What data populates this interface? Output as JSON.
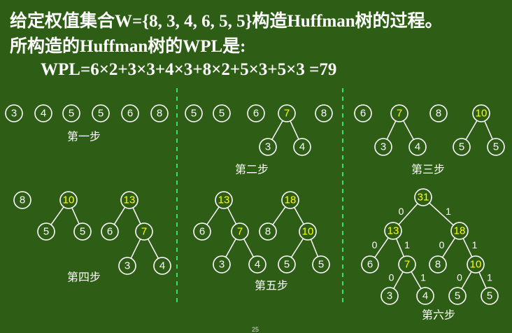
{
  "title": {
    "line1": "给定权值集合W={8, 3, 4, 6, 5, 5}构造Huffman树的过程。",
    "line2": "所构造的Huffman树的WPL是:"
  },
  "formula": "WPL=6×2+3×3+4×3+8×2+5×3+5×3 =79",
  "colors": {
    "background": "#2e5e16",
    "text": "#ffffff",
    "merged_node_text": "#ffff00",
    "divider": "#33e070"
  },
  "steps": [
    {
      "label": "第一步",
      "roots": [
        {
          "value": "3"
        },
        {
          "value": "4"
        },
        {
          "value": "5"
        },
        {
          "value": "5"
        },
        {
          "value": "6"
        },
        {
          "value": "8"
        }
      ]
    },
    {
      "label": "第二步",
      "roots": [
        {
          "value": "5"
        },
        {
          "value": "5"
        },
        {
          "value": "6"
        },
        {
          "value": "7",
          "merged": true,
          "children": [
            {
              "value": "3"
            },
            {
              "value": "4"
            }
          ]
        },
        {
          "value": "8"
        }
      ]
    },
    {
      "label": "第三步",
      "roots": [
        {
          "value": "6"
        },
        {
          "value": "7",
          "merged": true,
          "children": [
            {
              "value": "3"
            },
            {
              "value": "4"
            }
          ]
        },
        {
          "value": "8"
        },
        {
          "value": "10",
          "merged": true,
          "children": [
            {
              "value": "5"
            },
            {
              "value": "5"
            }
          ]
        }
      ]
    },
    {
      "label": "第四步",
      "roots": [
        {
          "value": "8"
        },
        {
          "value": "10",
          "merged": true,
          "children": [
            {
              "value": "5"
            },
            {
              "value": "5"
            }
          ]
        },
        {
          "value": "13",
          "merged": true,
          "children": [
            {
              "value": "6"
            },
            {
              "value": "7",
              "merged": true,
              "children": [
                {
                  "value": "3"
                },
                {
                  "value": "4"
                }
              ]
            }
          ]
        }
      ]
    },
    {
      "label": "第五步",
      "roots": [
        {
          "value": "13",
          "merged": true,
          "children": [
            {
              "value": "6"
            },
            {
              "value": "7",
              "merged": true,
              "children": [
                {
                  "value": "3"
                },
                {
                  "value": "4"
                }
              ]
            }
          ]
        },
        {
          "value": "18",
          "merged": true,
          "children": [
            {
              "value": "8"
            },
            {
              "value": "10",
              "merged": true,
              "children": [
                {
                  "value": "5"
                },
                {
                  "value": "5"
                }
              ]
            }
          ]
        }
      ]
    },
    {
      "label": "第六步",
      "roots": [
        {
          "value": "31",
          "merged": true,
          "edge_labels": [
            "0",
            "1"
          ],
          "children": [
            {
              "value": "13",
              "merged": true,
              "edge_labels": [
                "0",
                "1"
              ],
              "children": [
                {
                  "value": "6"
                },
                {
                  "value": "7",
                  "merged": true,
                  "edge_labels": [
                    "0",
                    "1"
                  ],
                  "children": [
                    {
                      "value": "3"
                    },
                    {
                      "value": "4"
                    }
                  ]
                }
              ]
            },
            {
              "value": "18",
              "merged": true,
              "edge_labels": [
                "0",
                "1"
              ],
              "children": [
                {
                  "value": "8"
                },
                {
                  "value": "10",
                  "merged": true,
                  "edge_labels": [
                    "0",
                    "1"
                  ],
                  "children": [
                    {
                      "value": "5"
                    },
                    {
                      "value": "5"
                    }
                  ]
                }
              ]
            }
          ]
        }
      ]
    }
  ],
  "page_number": "25"
}
